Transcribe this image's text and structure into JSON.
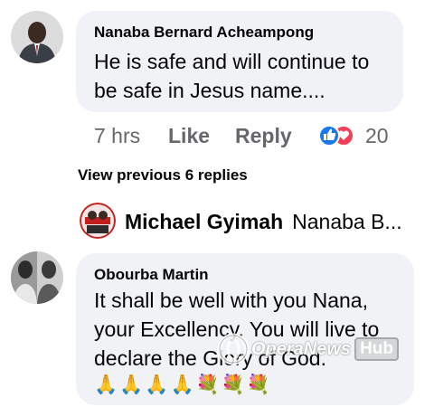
{
  "comment1": {
    "author": "Nanaba Bernard Acheampong",
    "text_line1": "He is safe and will continue to",
    "text_line2": "be safe in Jesus name....",
    "time": "7 hrs",
    "like_label": "Like",
    "reply_label": "Reply",
    "reaction_count": "20",
    "reactions": [
      "like-reaction-icon",
      "love-reaction-icon"
    ]
  },
  "view_previous": "View previous 6 replies",
  "reply_preview": {
    "author": "Michael Gyimah",
    "preview": "Nanaba B..."
  },
  "comment2": {
    "author": "Obourba Martin",
    "text_line1": "It shall be well with you Nana,",
    "text_line2": "your Excellency. You will live to",
    "text_line3": "declare the Glory of God.",
    "emojis": "🙏🙏🙏🙏💐💐💐"
  },
  "watermark": {
    "text": "OperaNews",
    "badge": "Hub"
  },
  "colors": {
    "bubble": "#f0f2f5",
    "secondary_text": "#65676b",
    "like_blue": "#1877f2",
    "love_red": "#f33e58"
  }
}
